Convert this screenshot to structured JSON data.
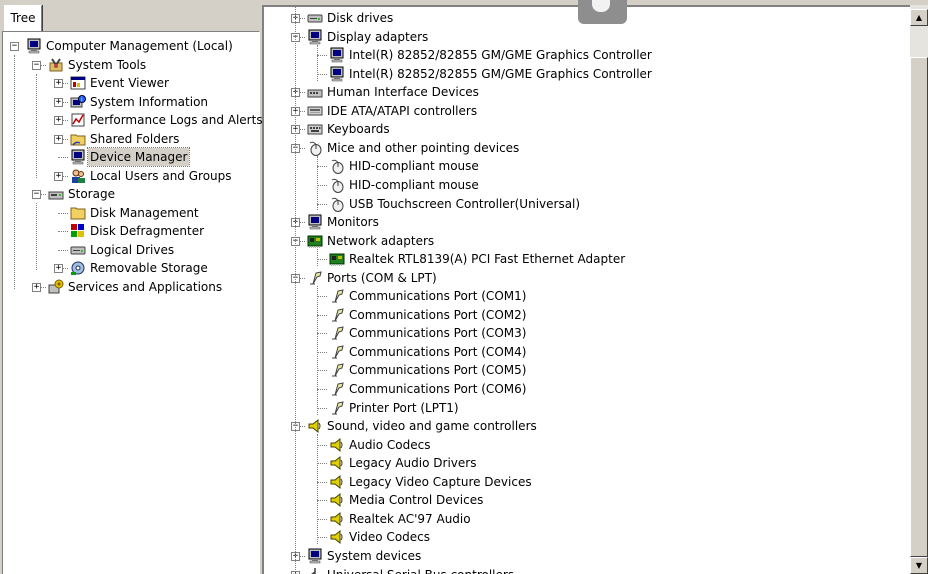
{
  "left_tab_label": "Tree",
  "left_tree": [
    {
      "label": "Computer Management (Local)",
      "icon": "computer-management-icon",
      "depth": 0,
      "expander": "minus"
    },
    {
      "label": "System Tools",
      "icon": "system-tools-icon",
      "depth": 1,
      "expander": "minus"
    },
    {
      "label": "Event Viewer",
      "icon": "event-viewer-icon",
      "depth": 2,
      "expander": "plus"
    },
    {
      "label": "System Information",
      "icon": "system-information-icon",
      "depth": 2,
      "expander": "plus"
    },
    {
      "label": "Performance Logs and Alerts",
      "icon": "performance-logs-icon",
      "depth": 2,
      "expander": "plus"
    },
    {
      "label": "Shared Folders",
      "icon": "shared-folders-icon",
      "depth": 2,
      "expander": "plus"
    },
    {
      "label": "Device Manager",
      "icon": "device-manager-icon",
      "depth": 2,
      "expander": "none",
      "selected": true
    },
    {
      "label": "Local Users and Groups",
      "icon": "local-users-icon",
      "depth": 2,
      "expander": "plus"
    },
    {
      "label": "Storage",
      "icon": "storage-icon",
      "depth": 1,
      "expander": "minus"
    },
    {
      "label": "Disk Management",
      "icon": "disk-management-icon",
      "depth": 2,
      "expander": "none"
    },
    {
      "label": "Disk Defragmenter",
      "icon": "disk-defragmenter-icon",
      "depth": 2,
      "expander": "none"
    },
    {
      "label": "Logical Drives",
      "icon": "logical-drives-icon",
      "depth": 2,
      "expander": "none"
    },
    {
      "label": "Removable Storage",
      "icon": "removable-storage-icon",
      "depth": 2,
      "expander": "plus"
    },
    {
      "label": "Services and Applications",
      "icon": "services-applications-icon",
      "depth": 1,
      "expander": "plus"
    }
  ],
  "device_tree": [
    {
      "label": "Disk drives",
      "icon": "disk-drive-icon",
      "depth": 0,
      "expander": "plus"
    },
    {
      "label": "Display adapters",
      "icon": "monitor-icon",
      "depth": 0,
      "expander": "minus"
    },
    {
      "label": "Intel(R) 82852/82855 GM/GME Graphics Controller",
      "icon": "monitor-icon",
      "depth": 1
    },
    {
      "label": "Intel(R) 82852/82855 GM/GME Graphics Controller",
      "icon": "monitor-icon",
      "depth": 1
    },
    {
      "label": "Human Interface Devices",
      "icon": "hid-icon",
      "depth": 0,
      "expander": "plus"
    },
    {
      "label": "IDE ATA/ATAPI controllers",
      "icon": "ide-controller-icon",
      "depth": 0,
      "expander": "plus"
    },
    {
      "label": "Keyboards",
      "icon": "keyboard-icon",
      "depth": 0,
      "expander": "plus"
    },
    {
      "label": "Mice and other pointing devices",
      "icon": "mouse-icon",
      "depth": 0,
      "expander": "minus"
    },
    {
      "label": "HID-compliant mouse",
      "icon": "mouse-icon",
      "depth": 1
    },
    {
      "label": "HID-compliant mouse",
      "icon": "mouse-icon",
      "depth": 1
    },
    {
      "label": "USB Touchscreen Controller(Universal)",
      "icon": "mouse-icon",
      "depth": 1
    },
    {
      "label": "Monitors",
      "icon": "monitor-icon",
      "depth": 0,
      "expander": "plus"
    },
    {
      "label": "Network adapters",
      "icon": "network-card-icon",
      "depth": 0,
      "expander": "minus"
    },
    {
      "label": "Realtek RTL8139(A) PCI Fast Ethernet Adapter",
      "icon": "network-card-icon",
      "depth": 1
    },
    {
      "label": "Ports (COM & LPT)",
      "icon": "port-icon",
      "depth": 0,
      "expander": "minus"
    },
    {
      "label": "Communications Port (COM1)",
      "icon": "port-icon",
      "depth": 1
    },
    {
      "label": "Communications Port (COM2)",
      "icon": "port-icon",
      "depth": 1
    },
    {
      "label": "Communications Port (COM3)",
      "icon": "port-icon",
      "depth": 1
    },
    {
      "label": "Communications Port (COM4)",
      "icon": "port-icon",
      "depth": 1
    },
    {
      "label": "Communications Port (COM5)",
      "icon": "port-icon",
      "depth": 1
    },
    {
      "label": "Communications Port (COM6)",
      "icon": "port-icon",
      "depth": 1
    },
    {
      "label": "Printer Port (LPT1)",
      "icon": "port-icon",
      "depth": 1
    },
    {
      "label": "Sound, video and game controllers",
      "icon": "speaker-icon",
      "depth": 0,
      "expander": "minus"
    },
    {
      "label": "Audio Codecs",
      "icon": "speaker-icon",
      "depth": 1
    },
    {
      "label": "Legacy Audio Drivers",
      "icon": "speaker-icon",
      "depth": 1
    },
    {
      "label": "Legacy Video Capture Devices",
      "icon": "speaker-icon",
      "depth": 1
    },
    {
      "label": "Media Control Devices",
      "icon": "speaker-icon",
      "depth": 1
    },
    {
      "label": "Realtek AC'97 Audio",
      "icon": "speaker-icon",
      "depth": 1
    },
    {
      "label": "Video Codecs",
      "icon": "speaker-icon",
      "depth": 1
    },
    {
      "label": "System devices",
      "icon": "monitor-icon",
      "depth": 0,
      "expander": "plus"
    },
    {
      "label": "Universal Serial Bus controllers",
      "icon": "usb-icon",
      "depth": 0,
      "expander": "plus"
    }
  ],
  "scroll_up_glyph": "▲",
  "scroll_down_glyph": "▼"
}
